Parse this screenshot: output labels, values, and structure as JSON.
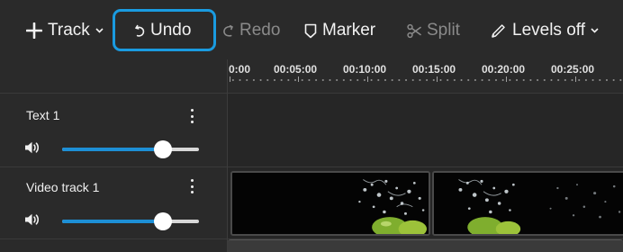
{
  "toolbar": {
    "track_label": "Track",
    "undo_label": "Undo",
    "redo_label": "Redo",
    "marker_label": "Marker",
    "split_label": "Split",
    "levels_label": "Levels off",
    "icons": [
      "plus-icon",
      "chevron-down-icon",
      "undo-icon",
      "redo-icon",
      "marker-icon",
      "scissors-icon",
      "pencil-icon",
      "chevron-down-icon"
    ],
    "highlight_color": "#1a9be0"
  },
  "ruler": {
    "ticks": [
      "0:00",
      "00:05:00",
      "00:10:00",
      "00:15:00",
      "00:20:00",
      "00:25:00"
    ]
  },
  "tracks": [
    {
      "name": "Text 1",
      "volume": 0.74,
      "icons": [
        "more-vertical-icon",
        "speaker-icon"
      ]
    },
    {
      "name": "Video track 1",
      "volume": 0.74,
      "icons": [
        "more-vertical-icon",
        "speaker-icon"
      ]
    }
  ],
  "colors": {
    "accent": "#1d8fd6",
    "background": "#252525",
    "panel": "#2a2a2a"
  }
}
